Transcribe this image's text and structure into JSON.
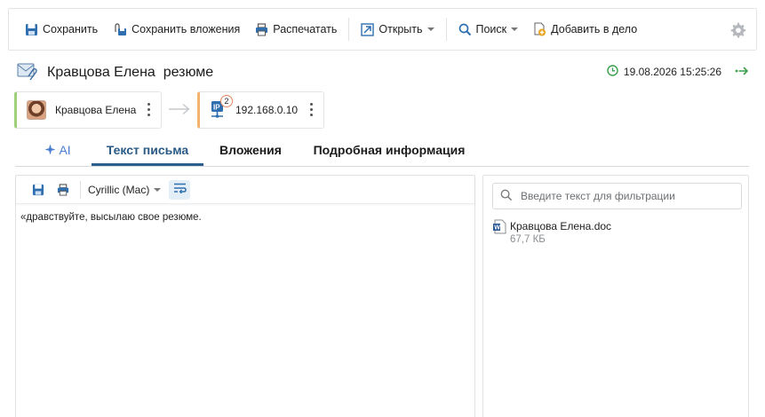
{
  "toolbar": {
    "save": "Сохранить",
    "save_attachments": "Сохранить вложения",
    "print": "Распечатать",
    "open": "Открыть",
    "search": "Поиск",
    "add_to_case": "Добавить в дело"
  },
  "header": {
    "subject": "Кравцова Елена  резюме",
    "datetime": "19.08.2026 15:25:26"
  },
  "chips": {
    "sender": "Кравцова Елена",
    "ip": "192.168.0.10",
    "ip_badge": "2",
    "ip_icon_text": "IP"
  },
  "tabs": [
    {
      "label": "AI"
    },
    {
      "label": "Текст письма"
    },
    {
      "label": "Вложения"
    },
    {
      "label": "Подробная информация"
    }
  ],
  "message": {
    "encoding": "Cyrillic (Mac)",
    "body": "«дравствуйте, высылаю свое резюме."
  },
  "attachments": {
    "filter_placeholder": "Введите текст для фильтрации",
    "items": [
      {
        "name": "Кравцова Елена.doc",
        "size": "67,7 КБ"
      }
    ]
  },
  "colors": {
    "accent": "#2d5f8c",
    "ai": "#4a7fd0",
    "sender_chip": "#9fd07a",
    "ip_chip": "#f3b26e",
    "clock": "#3aa04a"
  }
}
